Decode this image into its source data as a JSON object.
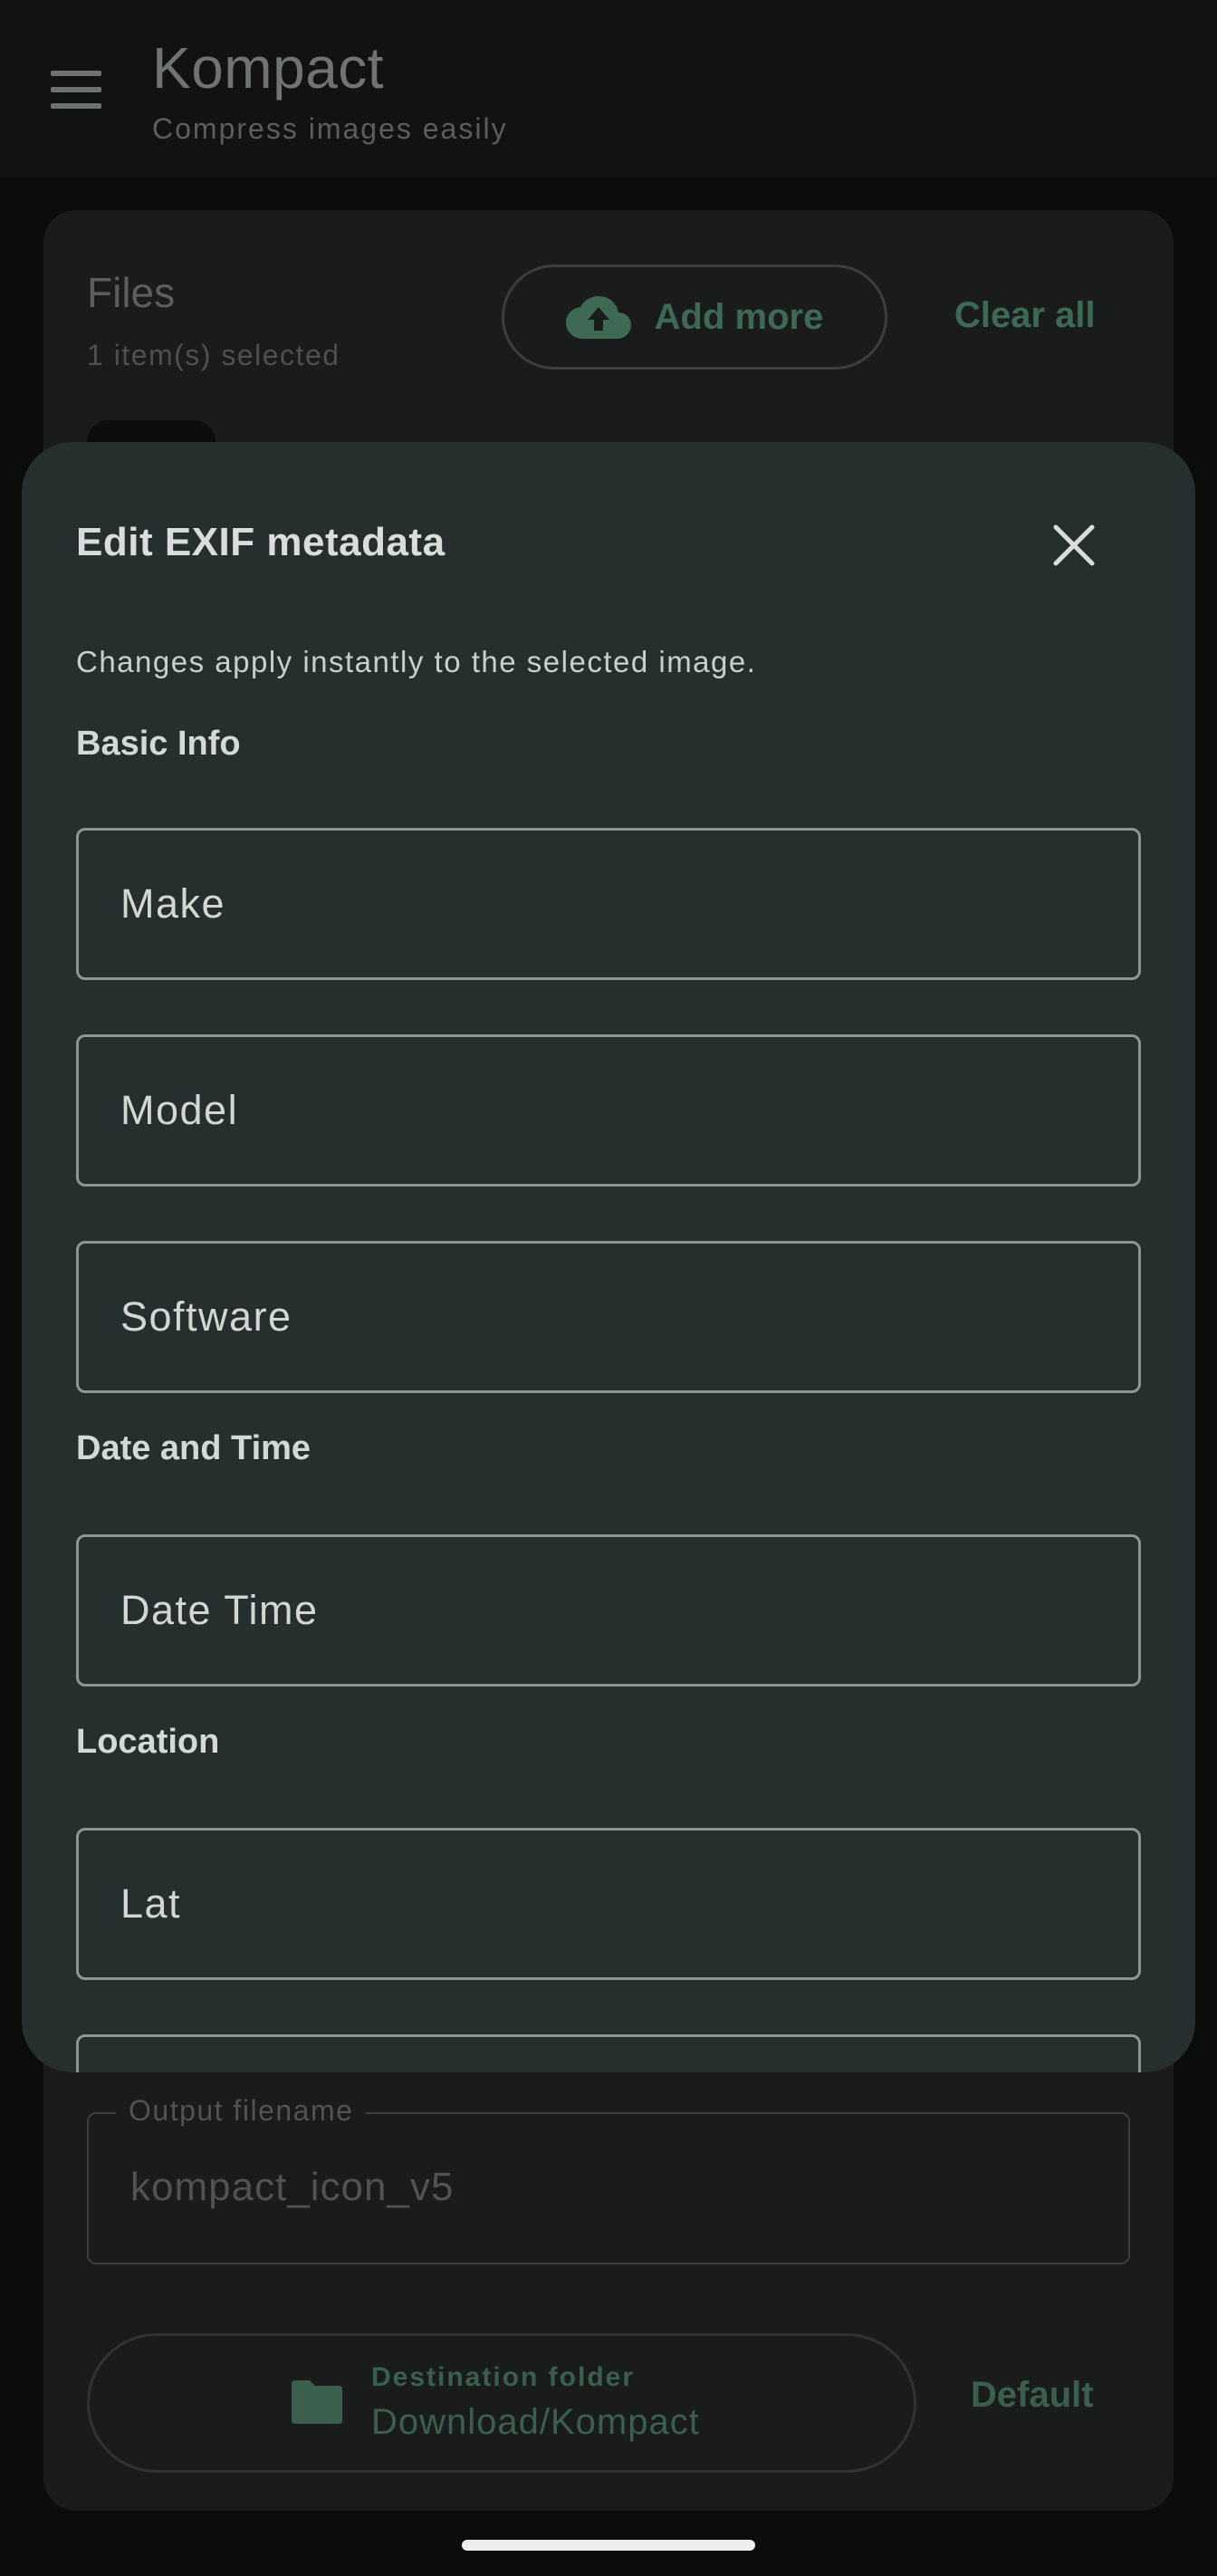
{
  "app_bar": {
    "title": "Kompact",
    "subtitle": "Compress images easily",
    "menu_icon": "hamburger-menu-icon"
  },
  "files_card": {
    "title": "Files",
    "count_text": "1 item(s) selected",
    "add_more_label": "Add more",
    "add_more_icon": "cloud-upload-icon",
    "clear_all_label": "Clear all"
  },
  "output": {
    "label": "Output filename",
    "value": "kompact_icon_v5"
  },
  "destination": {
    "label": "Destination folder",
    "value": "Download/Kompact",
    "icon": "folder-icon",
    "default_label": "Default"
  },
  "exif_sheet": {
    "title": "Edit EXIF metadata",
    "description": "Changes apply instantly to the selected image.",
    "sections": {
      "basic_info": "Basic Info",
      "date_time": "Date and Time",
      "location": "Location"
    },
    "fields": {
      "make": "Make",
      "model": "Model",
      "software": "Software",
      "date_time": "Date Time",
      "lat": "Lat"
    }
  },
  "colors": {
    "accent": "#3e6a55",
    "sheet_background": "#262f2d",
    "field_border": "#8e9693"
  }
}
